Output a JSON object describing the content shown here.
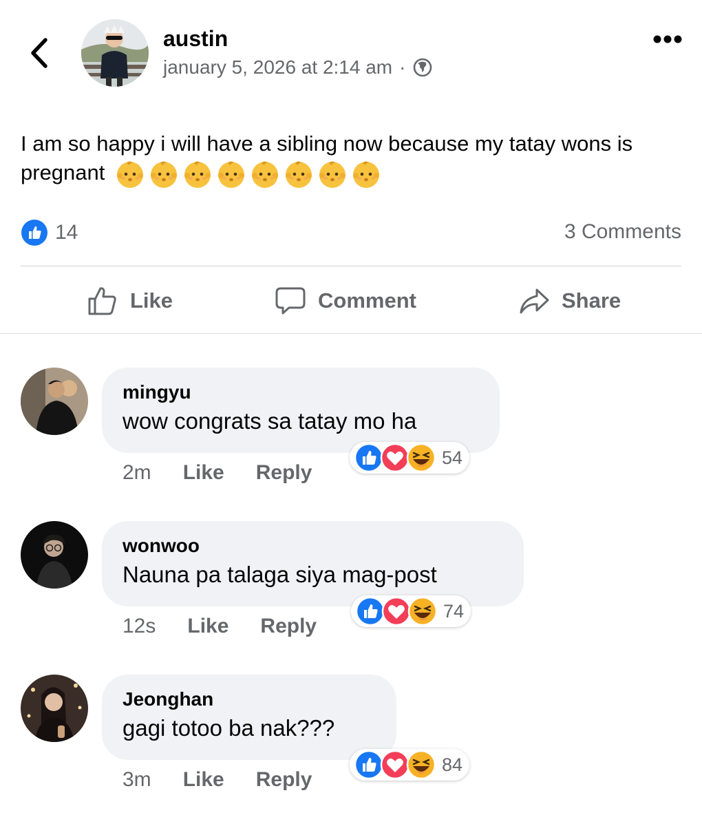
{
  "post": {
    "author": "austin",
    "timestamp": "january 5, 2026 at 2:14 am",
    "separator": "·",
    "privacy_icon": "globe-icon",
    "text": "I am so happy i will have a sibling now because my tatay wons is pregnant",
    "emoji": "baby-emoji",
    "emoji_count": 8,
    "like_count": "14",
    "comments_label": "3 Comments"
  },
  "actions": {
    "like": "Like",
    "comment": "Comment",
    "share": "Share"
  },
  "comments": [
    {
      "name": "mingyu",
      "text": "wow congrats sa tatay mo ha",
      "time": "2m",
      "like": "Like",
      "reply": "Reply",
      "reactions": "54"
    },
    {
      "name": "wonwoo",
      "text": "Nauna pa talaga siya mag-post",
      "time": "12s",
      "like": "Like",
      "reply": "Reply",
      "reactions": "74"
    },
    {
      "name": "Jeonghan",
      "text": "gagi totoo ba nak???",
      "time": "3m",
      "like": "Like",
      "reply": "Reply",
      "reactions": "84"
    }
  ],
  "colors": {
    "like_blue": "#1877f2",
    "love_red": "#f33e58",
    "haha_yellow": "#f7b125",
    "muted": "#65676b",
    "bubble": "#f0f2f5"
  }
}
